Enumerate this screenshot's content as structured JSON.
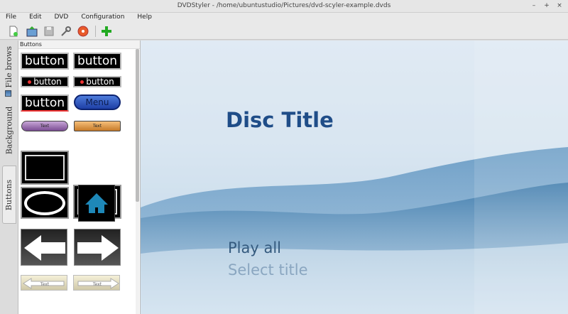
{
  "window": {
    "title": "DVDStyler - /home/ubuntustudio/Pictures/dvd-scyler-example.dvds"
  },
  "menu": [
    "File",
    "Edit",
    "DVD",
    "Configuration",
    "Help"
  ],
  "tabs": {
    "file_browser": "File brows",
    "background": "Background",
    "buttons": "Buttons"
  },
  "panel": {
    "header": "Buttons",
    "btn_text": "button",
    "menu_label": "Menu",
    "text_label": "Text"
  },
  "canvas": {
    "disc_title": "Disc Title",
    "play_all": "Play all",
    "select_title": "Select title"
  },
  "icons": [
    "new-icon",
    "open-icon",
    "save-icon",
    "settings-icon",
    "burn-icon",
    "add-icon"
  ]
}
